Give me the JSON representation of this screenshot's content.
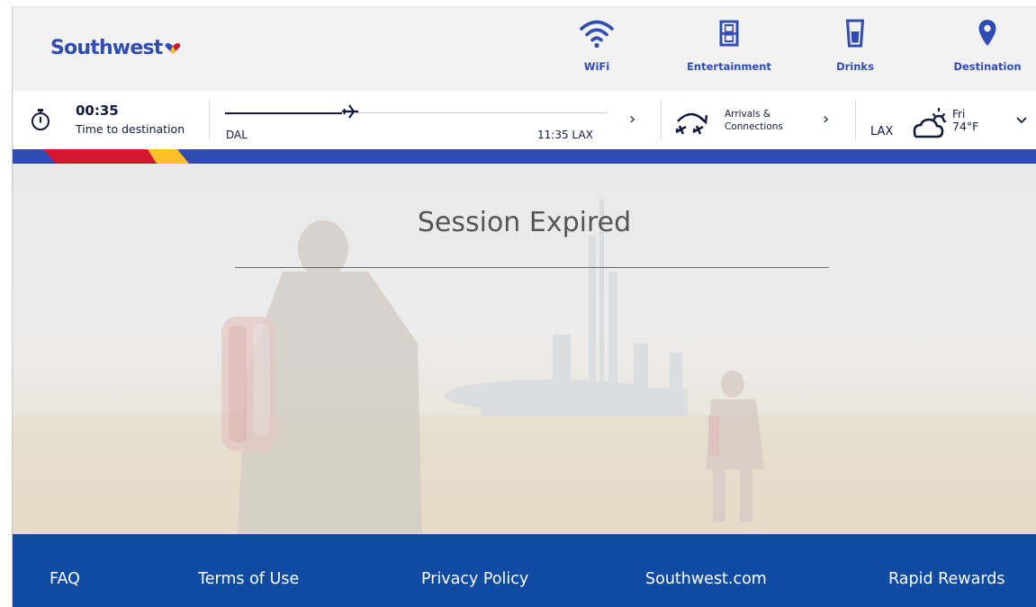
{
  "brand": {
    "name": "Southwest",
    "colors": {
      "blue": "#304cb2",
      "navy": "#111b40",
      "red": "#d5152e",
      "yellow": "#ffbf27",
      "footer_blue": "#0f4ba3"
    }
  },
  "nav": [
    {
      "label": "WiFi",
      "icon": "wifi-icon"
    },
    {
      "label": "Entertainment",
      "icon": "film-icon"
    },
    {
      "label": "Drinks",
      "icon": "drink-cup-icon"
    },
    {
      "label": "Destination",
      "icon": "map-pin-icon"
    }
  ],
  "flight": {
    "time_remaining": "00:35",
    "time_label": "Time to destination",
    "origin": "DAL",
    "arrival": "11:35 LAX",
    "progress_fraction": 0.35
  },
  "arrivals": {
    "label_line1": "Arrivals &",
    "label_line2": "Connections"
  },
  "weather": {
    "city": "LAX",
    "day": "Fri",
    "temp": "74°F",
    "icon": "partly-cloudy-icon"
  },
  "main": {
    "title": "Session Expired"
  },
  "footer": {
    "links": [
      "FAQ",
      "Terms of Use",
      "Privacy Policy",
      "Southwest.com",
      "Rapid Rewards"
    ]
  }
}
